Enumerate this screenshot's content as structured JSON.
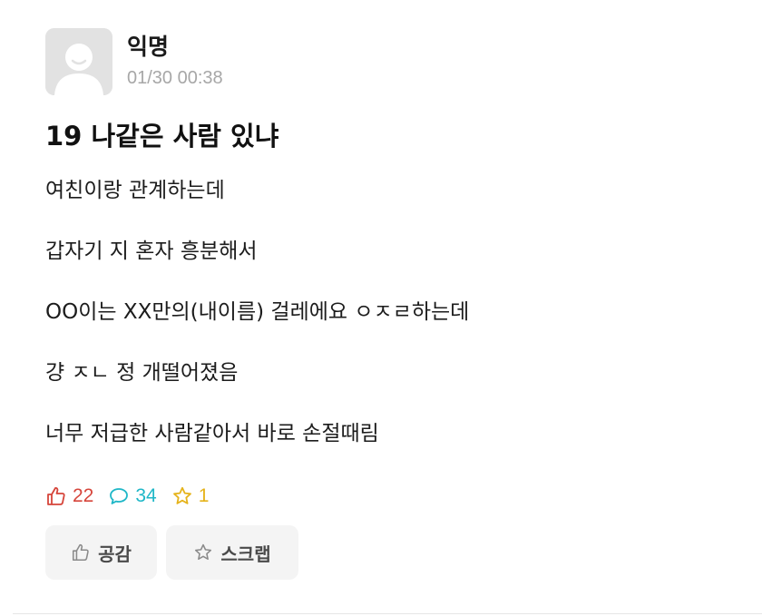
{
  "post": {
    "author": "익명",
    "timestamp": "01/30 00:38",
    "title": "19 나같은 사람 있냐",
    "body": [
      "여친이랑 관계하는데",
      "갑자기 지 혼자 흥분해서",
      "OO이는 XX만의(내이름) 걸레에요 ㅇㅈㄹ하는데",
      "걍 ㅈㄴ 정 개떨어졌음",
      "너무 저급한 사람같아서 바로 손절때림"
    ]
  },
  "stats": {
    "likes": "22",
    "comments": "34",
    "scraps": "1"
  },
  "actions": {
    "like_label": "공감",
    "scrap_label": "스크랩"
  },
  "icons": {
    "avatar": "anonymous-avatar-icon",
    "like": "thumbs-up-icon",
    "comment": "speech-bubble-icon",
    "scrap": "star-icon"
  },
  "colors": {
    "like": "#d6453b",
    "comment": "#1fb7c7",
    "scrap": "#e5b31b",
    "timestamp": "#a7a7a7",
    "button_bg": "#f4f4f4"
  }
}
